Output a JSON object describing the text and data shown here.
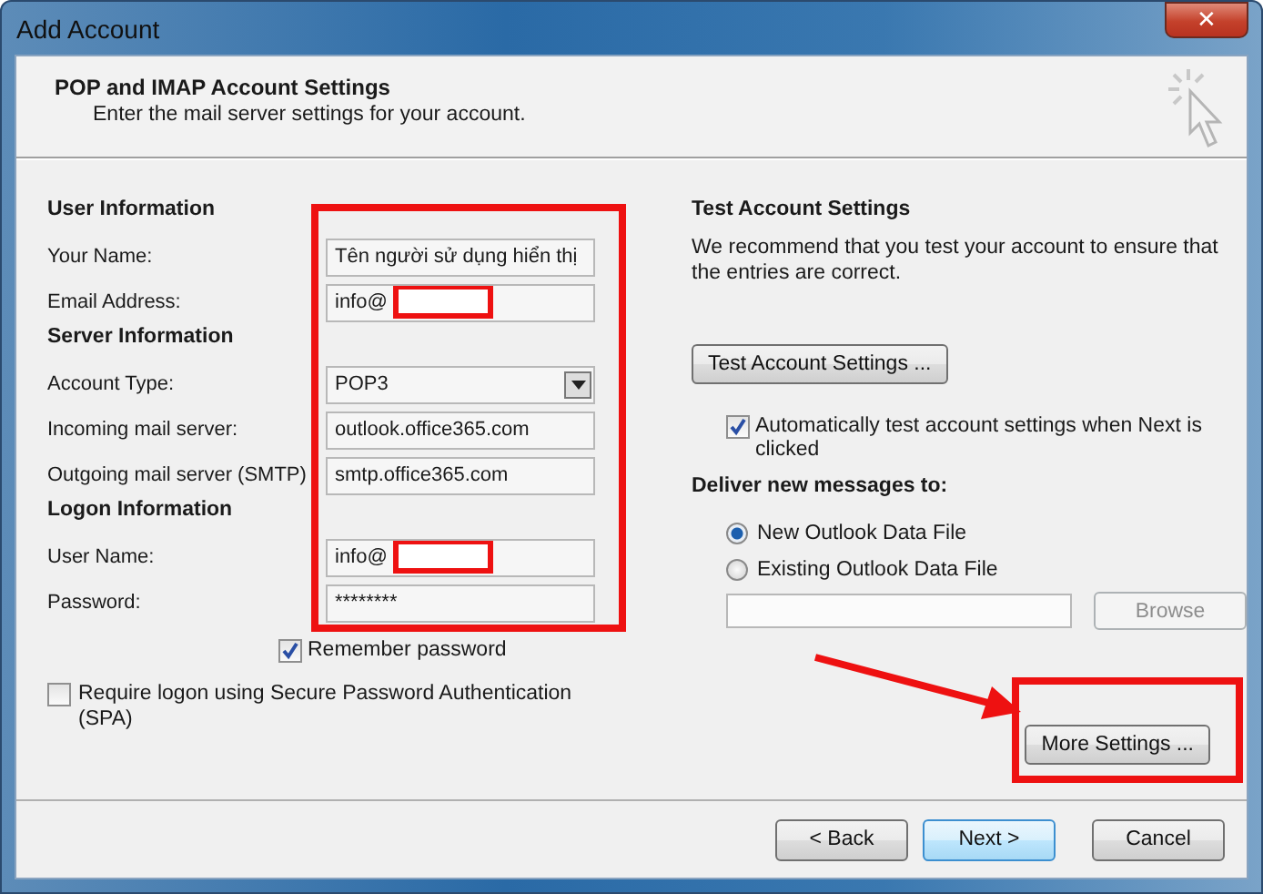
{
  "window": {
    "title": "Add Account",
    "close": "✕"
  },
  "header": {
    "title": "POP and IMAP Account Settings",
    "subtitle": "Enter the mail server settings for your account."
  },
  "left": {
    "highlighted": true,
    "sections": [
      {
        "heading": "User Information",
        "rows": [
          {
            "kind": "text",
            "label": "Your Name:",
            "value": "Tên người sử dụng hiển thị",
            "redacted": false
          },
          {
            "kind": "text",
            "label": "Email Address:",
            "value": "info@",
            "redacted": true
          }
        ]
      },
      {
        "heading": "Server Information",
        "rows": [
          {
            "kind": "select",
            "label": "Account Type:",
            "value": "POP3",
            "redacted": false
          },
          {
            "kind": "text",
            "label": "Incoming mail server:",
            "value": "outlook.office365.com",
            "redacted": false
          },
          {
            "kind": "text",
            "label": "Outgoing mail server (SMTP)",
            "value": "smtp.office365.com",
            "redacted": false
          }
        ]
      },
      {
        "heading": "Logon Information",
        "rows": [
          {
            "kind": "text",
            "label": "User Name:",
            "value": "info@",
            "redacted": true
          },
          {
            "kind": "password",
            "label": "Password:",
            "value": "********",
            "redacted": false
          }
        ]
      }
    ],
    "remember": {
      "label": "Remember password",
      "checked": true
    },
    "spa": {
      "label": "Require logon using Secure Password Authentication (SPA)",
      "checked": false
    }
  },
  "right": {
    "heading": "Test Account Settings",
    "text": "We recommend that you test your account to ensure that the entries are correct.",
    "test_button": "Test Account Settings ...",
    "auto_test": {
      "label": "Automatically test account settings when Next is clicked",
      "checked": true
    },
    "deliver_heading": "Deliver new messages to:",
    "options": [
      {
        "label": "New Outlook Data File",
        "selected": true
      },
      {
        "label": "Existing Outlook Data File",
        "selected": false
      }
    ],
    "browse": {
      "label": "Browse",
      "disabled": true
    },
    "more_settings": {
      "label": "More Settings ...",
      "highlighted": true
    }
  },
  "buttons": [
    {
      "label": "< Back",
      "default": false
    },
    {
      "label": "Next >",
      "default": true
    },
    {
      "label": "Cancel",
      "default": false
    }
  ]
}
